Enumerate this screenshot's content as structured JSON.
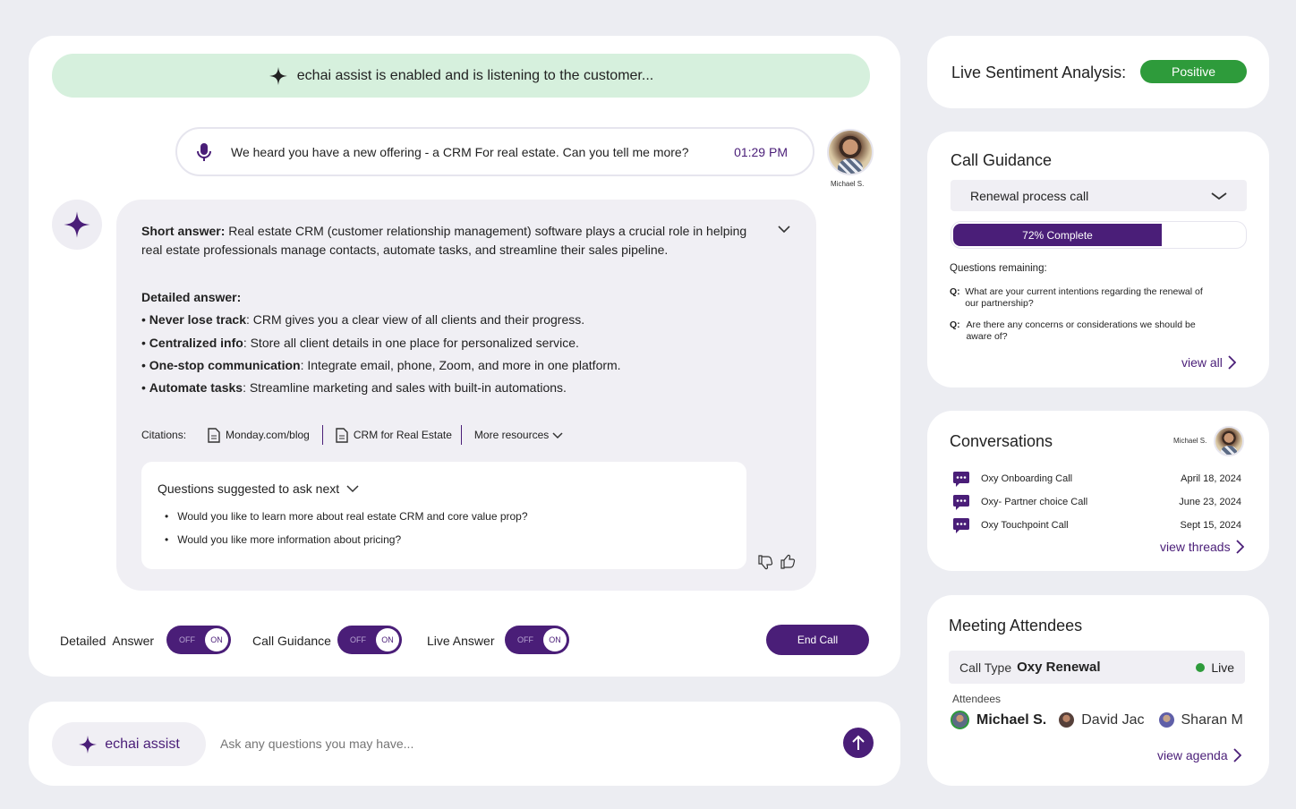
{
  "banner": {
    "text": "echai assist is enabled and is listening to the customer..."
  },
  "query": {
    "text": "We heard you have a new offering  - a CRM For real estate. Can you tell me more?",
    "time": "01:29 PM",
    "user": "Michael S."
  },
  "answer": {
    "short_label": "Short answer:",
    "short_text": " Real estate CRM (customer relationship management) software plays a crucial role in helping real estate professionals manage contacts, automate tasks, and streamline their sales pipeline.",
    "detailed_label": "Detailed answer:",
    "bullets": [
      {
        "bold": "Never lose track",
        "text": ": CRM gives you a clear view of all clients and their progress."
      },
      {
        "bold": "Centralized info",
        "text": ": Store all client details in one place for personalized service."
      },
      {
        "bold": "One-stop communication",
        "text": ": Integrate email, phone, Zoom, and more in one platform."
      },
      {
        "bold": "Automate tasks",
        "text": ": Streamline marketing and sales with built-in automations."
      }
    ],
    "citations_label": "Citations:",
    "citations": [
      "Monday.com/blog",
      "CRM for Real Estate"
    ],
    "more_resources": "More resources",
    "suggest_title": "Questions suggested to ask next",
    "suggestions": [
      "Would you like to learn more about real estate CRM and core value prop?",
      "Would you like more information about pricing?"
    ]
  },
  "toggles": [
    {
      "label": "Detailed  Answer",
      "off": "OFF",
      "on": "ON"
    },
    {
      "label": "Call Guidance",
      "off": "OFF",
      "on": "ON"
    },
    {
      "label": "Live Answer",
      "off": "OFF",
      "on": "ON"
    }
  ],
  "end_call": "End Call",
  "input": {
    "assist_label": "echai assist",
    "placeholder": "Ask any questions you may have..."
  },
  "sentiment": {
    "label": "Live Sentiment Analysis:",
    "value": "Positive",
    "color": "#2e9b3b"
  },
  "guidance": {
    "title": "Call Guidance",
    "selected": "Renewal process call",
    "progress": 0.72,
    "progress_label": "72% Complete",
    "remaining_label": "Questions remaining:",
    "questions": [
      {
        "q": "Q:",
        "text": "What are your current intentions regarding the renewal of our partnership?"
      },
      {
        "q": "Q:",
        "text": "Are there any concerns or considerations we should be aware of?"
      }
    ],
    "view_all": "view all"
  },
  "conversations": {
    "title": "Conversations",
    "user": "Michael S.",
    "items": [
      {
        "name": "Oxy Onboarding Call",
        "date": "April 18,  2024"
      },
      {
        "name": "Oxy- Partner choice Call",
        "date": "June 23,  2024"
      },
      {
        "name": "Oxy Touchpoint Call",
        "date": "Sept 15,  2024"
      }
    ],
    "view_threads": "view threads"
  },
  "meeting": {
    "title": "Meeting Attendees",
    "call_type_label": "Call Type",
    "call_type_value": "Oxy Renewal",
    "live": "Live",
    "attendees_label": "Attendees",
    "attendees": [
      "Michael S.",
      "David Jac",
      "Sharan M"
    ],
    "view_agenda": "view agenda"
  }
}
